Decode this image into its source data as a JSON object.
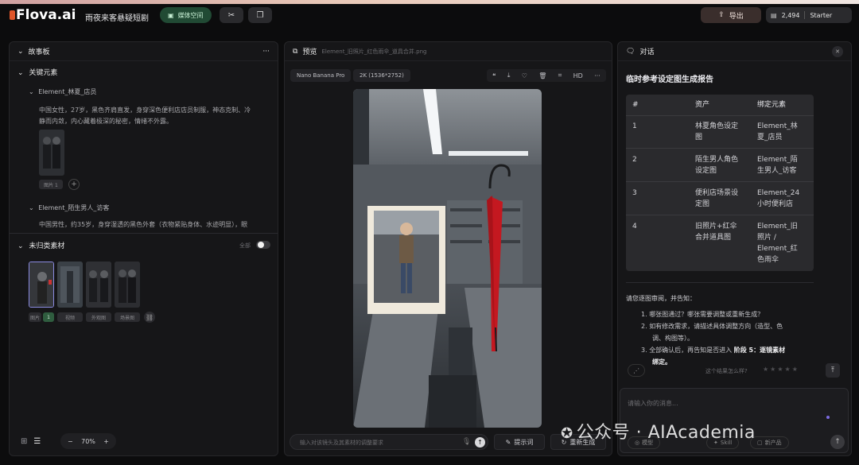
{
  "topbar": {
    "logo": "Flova.ai",
    "project_title": "雨夜来客悬疑短剧",
    "media_space": "媒体空间",
    "export": "导出",
    "credits": "2,494",
    "plan": "Starter"
  },
  "storyboard": {
    "title": "故事板",
    "key_elements": "关键元素",
    "element1": {
      "name": "Element_林夏_店员",
      "desc1": "中国女性，27岁，黑色齐肩直发，身穿深色便利店店员制服，神态克制、冷",
      "desc2": "静而内敛，内心藏着极深的秘密，情绪不外露。",
      "tag": "图片 1"
    },
    "element2": {
      "name": "Element_陌生男人_访客",
      "desc": "中国男性，约35岁，身穿湿透的黑色外套（衣物紧贴身体、水迹明显），眼"
    },
    "uncategorized": "未归类素材",
    "all_label": "全部",
    "mini_tags": [
      "图片",
      "1",
      "视频",
      "外观图",
      "场景图"
    ]
  },
  "bottom_left": {
    "zoom": "70%",
    "minus": "−",
    "plus": "+"
  },
  "preview": {
    "title": "预览",
    "filename": "Element_旧照片_红色雨伞_道具合并.png",
    "model_chip": "Nano Banana Pro",
    "res_chip": "2K (1536*2752)",
    "hd": "HD",
    "input_placeholder": "输入对该镜头及其素材的调整要求",
    "prompt_btn": "提示词",
    "regen_btn": "重新生成"
  },
  "chat": {
    "title": "对话",
    "report_title": "临时参考设定图生成报告",
    "headers": [
      "#",
      "资产",
      "绑定元素"
    ],
    "rows": [
      {
        "n": "1",
        "asset": [
          "林夏角色设定",
          "图"
        ],
        "bind": [
          "Element_林",
          "夏_店员"
        ]
      },
      {
        "n": "2",
        "asset": [
          "陌生男人角色",
          "设定图"
        ],
        "bind": [
          "Element_陌",
          "生男人_访客"
        ]
      },
      {
        "n": "3",
        "asset": [
          "便利店场景设",
          "定图"
        ],
        "bind": [
          "Element_24",
          "小时便利店"
        ]
      },
      {
        "n": "4",
        "asset": [
          "旧照片+红伞",
          "合并道具图"
        ],
        "bind": [
          "Element_旧",
          "照片 /",
          "Element_红",
          "色雨伞"
        ]
      }
    ],
    "review_intro": "请您逐图审阅，并告知：",
    "list": [
      {
        "num": "1.",
        "text": "哪张图通过？哪张需要调整或重新生成？"
      },
      {
        "num": "2.",
        "text": "如有修改需求，请描述具体调整方向（造型、色"
      },
      {
        "num": "",
        "text": "调、构图等）。"
      },
      {
        "num": "3.",
        "text": "全部确认后，再告知是否进入 "
      },
      {
        "num": "",
        "text": "绑定。"
      }
    ],
    "stage_bold": "阶段 5：逐镜素材",
    "feedback": "这个结果怎么样?",
    "input_placeholder": "请输入你的消息...",
    "bottom_btns": [
      "模型",
      "Skill",
      "新产品"
    ]
  },
  "watermark": "公众号 · AIAcademia"
}
